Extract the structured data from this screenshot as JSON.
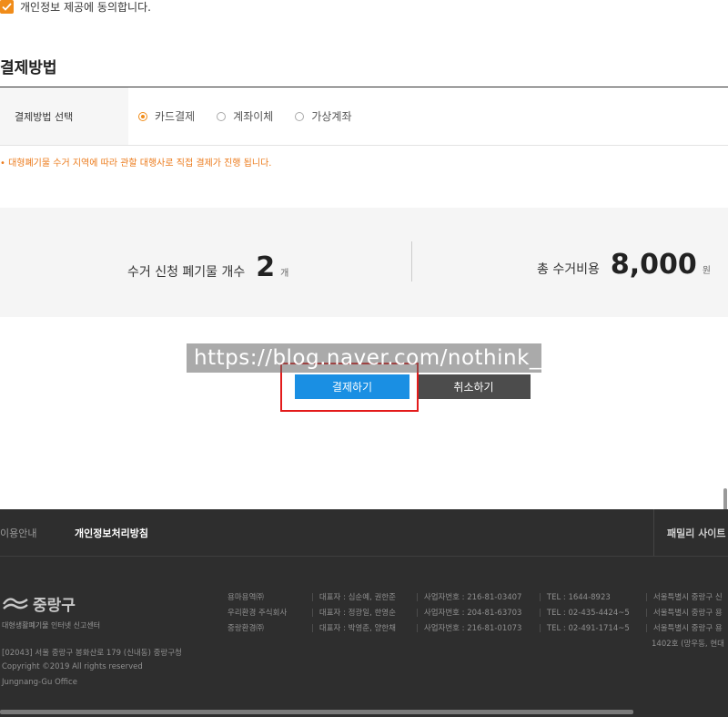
{
  "consent": {
    "text": "개인정보 제공에 동의합니다."
  },
  "payment": {
    "section_title": "결제방법",
    "row_label": "결제방법 선택",
    "options": [
      {
        "label": "카드결제",
        "selected": true
      },
      {
        "label": "계좌이체",
        "selected": false
      },
      {
        "label": "가상계좌",
        "selected": false
      }
    ],
    "notice": "• 대형폐기물 수거 지역에 따라 관할 대행사로 직접 결제가 진행 됩니다."
  },
  "summary": {
    "count_label": "수거 신청 폐기물 개수",
    "count_value": "2",
    "count_unit": "개",
    "cost_label": "총 수거비용",
    "cost_value": "8,000",
    "cost_unit": "원"
  },
  "buttons": {
    "pay": "결제하기",
    "cancel": "취소하기"
  },
  "watermark": "https://blog.naver.com/nothink__",
  "colors": {
    "accent": "#f08c1a",
    "pay": "#1a8fe3",
    "cancel": "#4c4c4c",
    "highlight": "#e31b1b",
    "footer": "#2e2e2e"
  },
  "footer": {
    "nav": {
      "usage": "이용안내",
      "privacy": "개인정보처리방침",
      "family": "패밀리 사이트"
    },
    "logo": {
      "name": "중랑구",
      "sub": "대형생활폐기물 인터넷 신고센터"
    },
    "address": "[02043] 서울 중랑구 봉화산로 179 (신내동) 중랑구청",
    "copyright": "Copyright ©2019 All rights reserved",
    "office": "Jungnang-Gu Office",
    "companies": [
      {
        "name": "용마용역㈜",
        "ceo": "대표자 : 심순예, 권한준",
        "biz": "사업자번호 : 216-81-03407",
        "tel": "TEL : 1644-8923",
        "addr": "서울특별시 중랑구 신"
      },
      {
        "name": "우리환경 주식회사",
        "ceo": "대표자 : 정광일, 한영순",
        "biz": "사업자번호 : 204-81-63703",
        "tel": "TEL : 02-435-4424~5",
        "addr": "서울특별시 중랑구 용"
      },
      {
        "name": "중랑환경㈜",
        "ceo": "대표자 : 박영춘, 양한채",
        "biz": "사업자번호 : 216-81-01073",
        "tel": "TEL : 02-491-1714~5",
        "addr": "서울특별시 중랑구 용"
      }
    ],
    "addr_extra": "1402호 (망우동, 현대"
  }
}
